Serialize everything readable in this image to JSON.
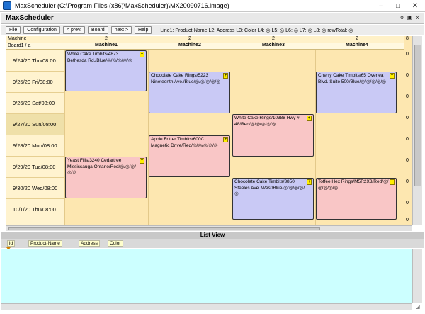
{
  "window": {
    "title": "MaxScheduler (C:\\Program Files (x86)\\MaxScheduler)\\MX20090716.image)",
    "app_name": "MaxScheduler",
    "controls": {
      "minimize": "–",
      "maximize": "□",
      "close": "✕"
    }
  },
  "toolbar": {
    "buttons": [
      "File",
      "Configuration",
      "< prev.",
      "Board",
      "next >",
      "Help"
    ],
    "line_info": "Line1: Product-Name L2: Address L3: Color  L4: ◎  L5: ◎  L6: ◎  L7: ◎  L8: ◎ rowTotal: ◎"
  },
  "scheduler": {
    "machine_label": "Machine",
    "board_label": "Board1 / a",
    "machines": [
      {
        "name": "Machine1",
        "count": "2"
      },
      {
        "name": "Machine2",
        "count": "2"
      },
      {
        "name": "Machine3",
        "count": "2"
      },
      {
        "name": "Machine4",
        "count": "2"
      }
    ],
    "total_count": "8",
    "dates": [
      "9/24/20 Thu/08:00",
      "9/25/20 Fri/08:00",
      "9/26/20 Sat/08:00",
      "9/27/20 Sun/08:00",
      "9/28/20 Mon/08:00",
      "9/29/20 Tue/08:00",
      "9/30/20 Wed/08:00",
      "10/1/20 Thu/08:00"
    ],
    "row_totals": [
      "0",
      "0",
      "0",
      "0",
      "0",
      "0",
      "0",
      "0",
      "0"
    ],
    "tasks": [
      {
        "text": "White Cake Timbits/4873 Bethesda Rd./Blue/◎/◎/◎/◎/◎",
        "color": "blue"
      },
      {
        "text": "Chocolate Cake Rings/5223 Nineteenth Ave./Blue/◎/◎/◎/◎/◎",
        "color": "blue"
      },
      {
        "text": "Cherry Cake Timbits/65 Overlea Blvd. Suite 500/Blue/◎/◎/◎/◎/◎",
        "color": "blue"
      },
      {
        "text": "White Cake Rings/10388 Hwy # 48/Red/◎/◎/◎/◎/◎",
        "color": "pink"
      },
      {
        "text": "Apple Fritter Timbits/600C Magnetic Drive/Red/◎/◎/◎/◎/◎",
        "color": "pink"
      },
      {
        "text": "Yeast Fills/3240 Cedartree Mississauga Ontario/Red/◎/◎/◎/◎/◎",
        "color": "pink"
      },
      {
        "text": "Chocolate Cake Timbits/3850 Steeles Ave. West/Blue/◎/◎/◎/◎/◎",
        "color": "blue"
      },
      {
        "text": "Toffee Hex Rings/M5R2X3/Red/◎/◎/◎/◎/◎",
        "color": "pink"
      }
    ],
    "flag_symbol": "+"
  },
  "list_view": {
    "title": "List View",
    "columns": [
      "id",
      "Product-Name",
      "Address",
      "Color"
    ]
  },
  "colors": {
    "task_blue": "#c9c9f5",
    "task_pink": "#f9c6c6",
    "grid_bg": "#fde7b0",
    "list_bg": "#ccffff",
    "flag": "#ffee00"
  }
}
